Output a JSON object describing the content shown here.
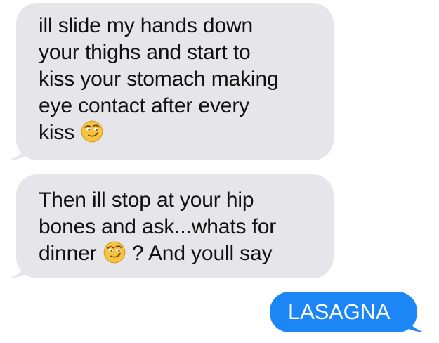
{
  "conversation": {
    "messages": [
      {
        "sender": "received",
        "lines": [
          "ill slide my hands down",
          "your thighs and start to",
          "kiss your stomach making",
          "eye contact after every",
          "kiss"
        ],
        "emoji": "smirking-face-emoji"
      },
      {
        "sender": "received",
        "lines": [
          "Then ill stop at your hip",
          "bones and ask...whats for",
          "dinner"
        ],
        "after_emoji_text": "? And youll say",
        "emoji": "smirking-face-emoji"
      },
      {
        "sender": "sent",
        "text": "LASAGNA"
      }
    ]
  },
  "colors": {
    "received_bubble": "#e5e5ea",
    "received_text": "#111111",
    "sent_bubble": "#1d86f6",
    "sent_text": "#ffffff",
    "emoji_face": "#f5c342"
  }
}
